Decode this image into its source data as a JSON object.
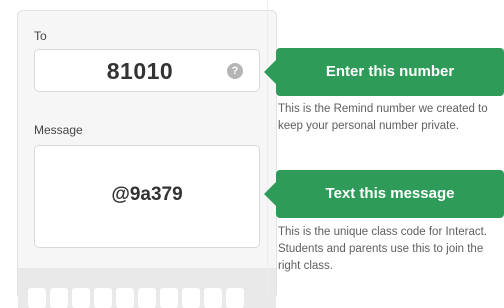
{
  "phone": {
    "to_label": "To",
    "to_number": "81010",
    "help_symbol": "?",
    "message_label": "Message",
    "message_code": "@9a379"
  },
  "callouts": [
    {
      "title": "Enter this number",
      "description": "This is the Remind number we created to keep your personal number private."
    },
    {
      "title": "Text this message",
      "description": "This is the unique class code for Interact. Students and parents use this to join the right class."
    }
  ],
  "colors": {
    "accent_green": "#2f9b58",
    "panel_bg": "#f6f6f6",
    "muted_text": "#5f5f5f"
  },
  "icons": {
    "help": "question-circle-icon"
  }
}
